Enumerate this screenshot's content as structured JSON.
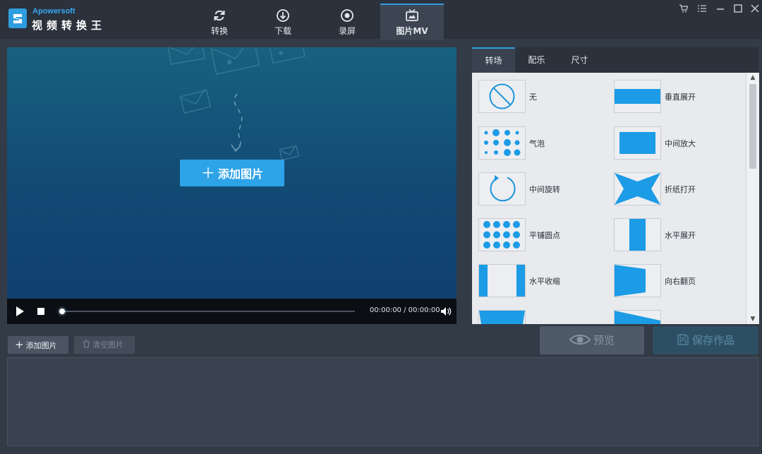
{
  "app": {
    "brand_en": "Apowersoft",
    "brand_cn": "视频转换王"
  },
  "nav": {
    "tabs": [
      {
        "label": "转换",
        "icon": "refresh-icon"
      },
      {
        "label": "下载",
        "icon": "download-icon"
      },
      {
        "label": "录屏",
        "icon": "record-icon"
      },
      {
        "label": "图片MV",
        "icon": "tv-icon",
        "active": true
      }
    ]
  },
  "window_controls": [
    "cart-icon",
    "menu-icon",
    "minimize-icon",
    "maximize-icon",
    "close-icon"
  ],
  "preview": {
    "add_button": "添加图片",
    "time": "00:00:00 / 00:00:00",
    "progress": 0
  },
  "panel": {
    "tabs": [
      {
        "label": "转场",
        "active": true
      },
      {
        "label": "配乐"
      },
      {
        "label": "尺寸"
      }
    ],
    "transitions": [
      {
        "label": "无",
        "icon": "none-icon"
      },
      {
        "label": "垂直展开",
        "icon": "vertical-expand-icon"
      },
      {
        "label": "气泡",
        "icon": "bubble-icon"
      },
      {
        "label": "中间放大",
        "icon": "center-zoom-icon"
      },
      {
        "label": "中间旋转",
        "icon": "center-rotate-icon"
      },
      {
        "label": "折纸打开",
        "icon": "origami-open-icon"
      },
      {
        "label": "平铺圆点",
        "icon": "tile-dots-icon"
      },
      {
        "label": "水平展开",
        "icon": "horizontal-expand-icon"
      },
      {
        "label": "水平收缩",
        "icon": "horizontal-shrink-icon"
      },
      {
        "label": "向右翻页",
        "icon": "page-flip-right-icon"
      }
    ]
  },
  "toolbar": {
    "add_label": "添加图片",
    "clear_label": "清空图片",
    "preview_label": "预览",
    "save_label": "保存作品"
  },
  "colors": {
    "accent": "#2ea3e7",
    "titlebar": "#2b323c",
    "background": "#333b47"
  }
}
